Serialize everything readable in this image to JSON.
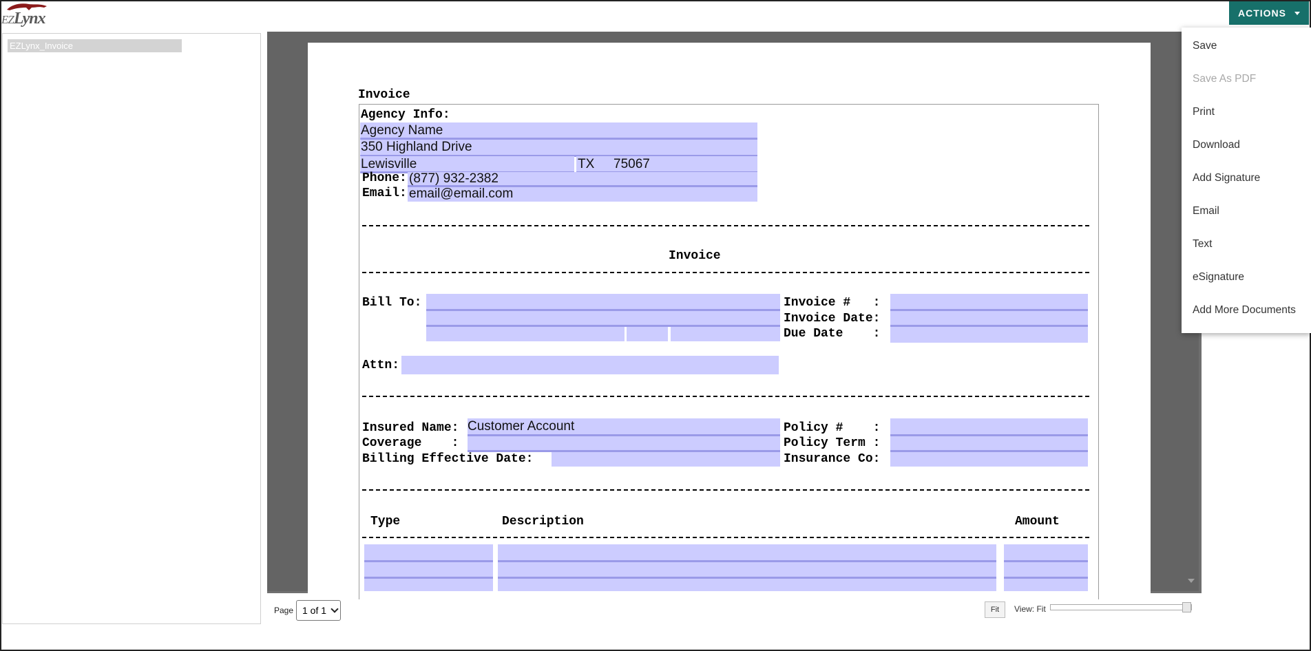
{
  "header": {
    "logo_prefix": "EZ",
    "logo_text": "Lynx",
    "actions_label": "ACTIONS"
  },
  "sidebar": {
    "items": [
      {
        "label": "EZLynx_Invoice",
        "selected": true
      }
    ]
  },
  "document": {
    "top_title": "Invoice",
    "agency_info_label": "Agency Info:",
    "agency_name": "Agency Name",
    "address": "350 Highland Drive",
    "city": "Lewisville",
    "state": "TX",
    "zip": "75067",
    "phone_label": "Phone:",
    "phone": "(877) 932-2382",
    "email_label": "Email:",
    "email": "email@email.com",
    "section_title": "Invoice",
    "bill_to_label": "Bill To:",
    "invoice_num_label": "Invoice #   :",
    "invoice_date_label": "Invoice Date:",
    "due_date_label": "Due Date    :",
    "attn_label": "Attn:",
    "insured_name_label": "Insured Name:",
    "insured_name": "Customer Account",
    "coverage_label": "Coverage    :",
    "billing_eff_label": "Billing Effective Date:",
    "policy_num_label": "Policy #    :",
    "policy_term_label": "Policy Term :",
    "insurance_co_label": "Insurance Co:",
    "col_type": "Type",
    "col_description": "Description",
    "col_amount": "Amount"
  },
  "viewer_controls": {
    "page_label": "Page",
    "page_value": "1 of 1",
    "fit_label": "Fit",
    "view_label": "View: Fit",
    "zoom_level": 1.0
  },
  "actions_menu": {
    "items": [
      {
        "label": "Save",
        "enabled": true
      },
      {
        "label": "Save As PDF",
        "enabled": false
      },
      {
        "label": "Print",
        "enabled": true
      },
      {
        "label": "Download",
        "enabled": true
      },
      {
        "label": "Add Signature",
        "enabled": true
      },
      {
        "label": "Email",
        "enabled": true
      },
      {
        "label": "Text",
        "enabled": true
      },
      {
        "label": "eSignature",
        "enabled": true
      },
      {
        "label": "Add More Documents",
        "enabled": true
      }
    ]
  },
  "colors": {
    "accent": "#17706a",
    "field_fill": "#ccccff",
    "viewer_bg": "#646464"
  }
}
